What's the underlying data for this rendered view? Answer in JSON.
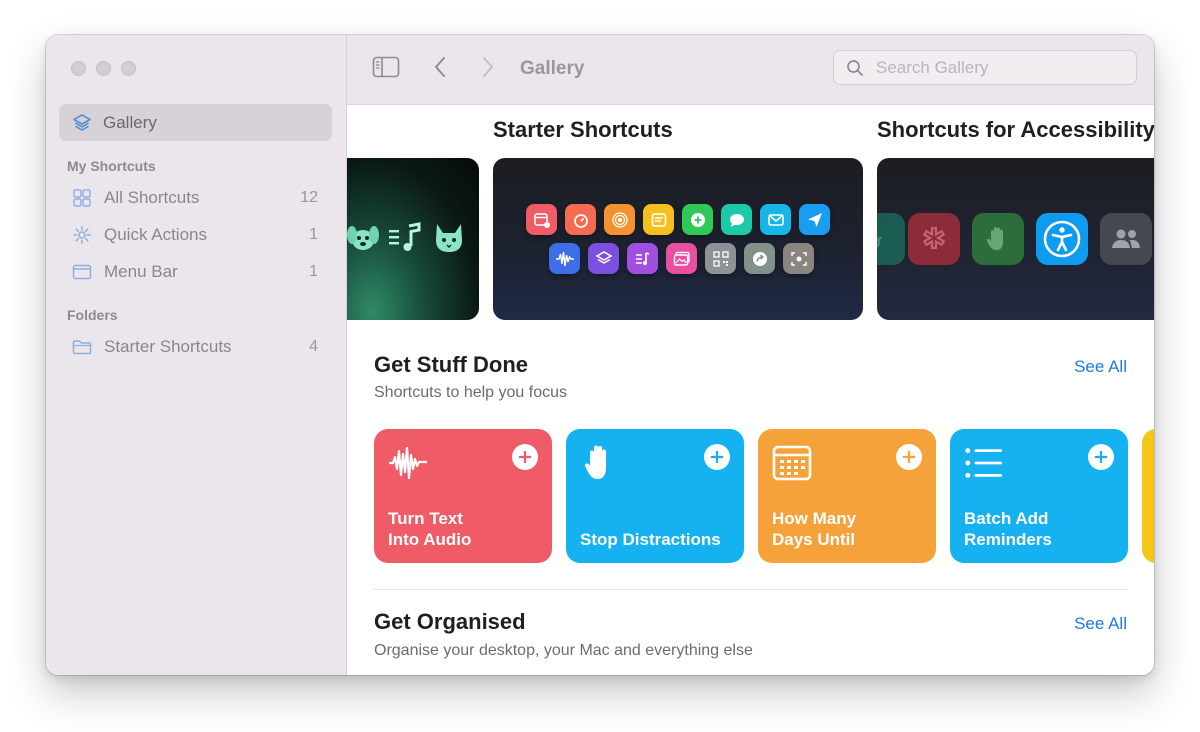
{
  "sidebar": {
    "gallery_label": "Gallery",
    "my_shortcuts_header": "My Shortcuts",
    "items": [
      {
        "label": "All Shortcuts",
        "count": "12"
      },
      {
        "label": "Quick Actions",
        "count": "1"
      },
      {
        "label": "Menu Bar",
        "count": "1"
      }
    ],
    "folders_header": "Folders",
    "folders": [
      {
        "label": "Starter Shortcuts",
        "count": "4"
      }
    ]
  },
  "toolbar": {
    "title": "Gallery",
    "search_placeholder": "Search Gallery"
  },
  "featured": {
    "starter_title": "Starter Shortcuts",
    "accessibility_title": "Shortcuts for Accessibility"
  },
  "sections": {
    "get_stuff_done": {
      "title": "Get Stuff Done",
      "subtitle": "Shortcuts to help you focus",
      "see_all": "See All",
      "cards": [
        {
          "label": "Turn Text Into Audio",
          "color": "#ef5b66"
        },
        {
          "label": "Stop Distractions",
          "color": "#15b1f0"
        },
        {
          "label": "How Many Days Until",
          "color": "#f5a23a"
        },
        {
          "label": "Batch Add Reminders",
          "color": "#15b1f0"
        }
      ]
    },
    "get_organised": {
      "title": "Get Organised",
      "subtitle": "Organise your desktop, your Mac and everything else",
      "see_all": "See All"
    }
  },
  "colors": {
    "accent": "#1f7ae0",
    "sidebar_bg": "#ebe6ec"
  }
}
